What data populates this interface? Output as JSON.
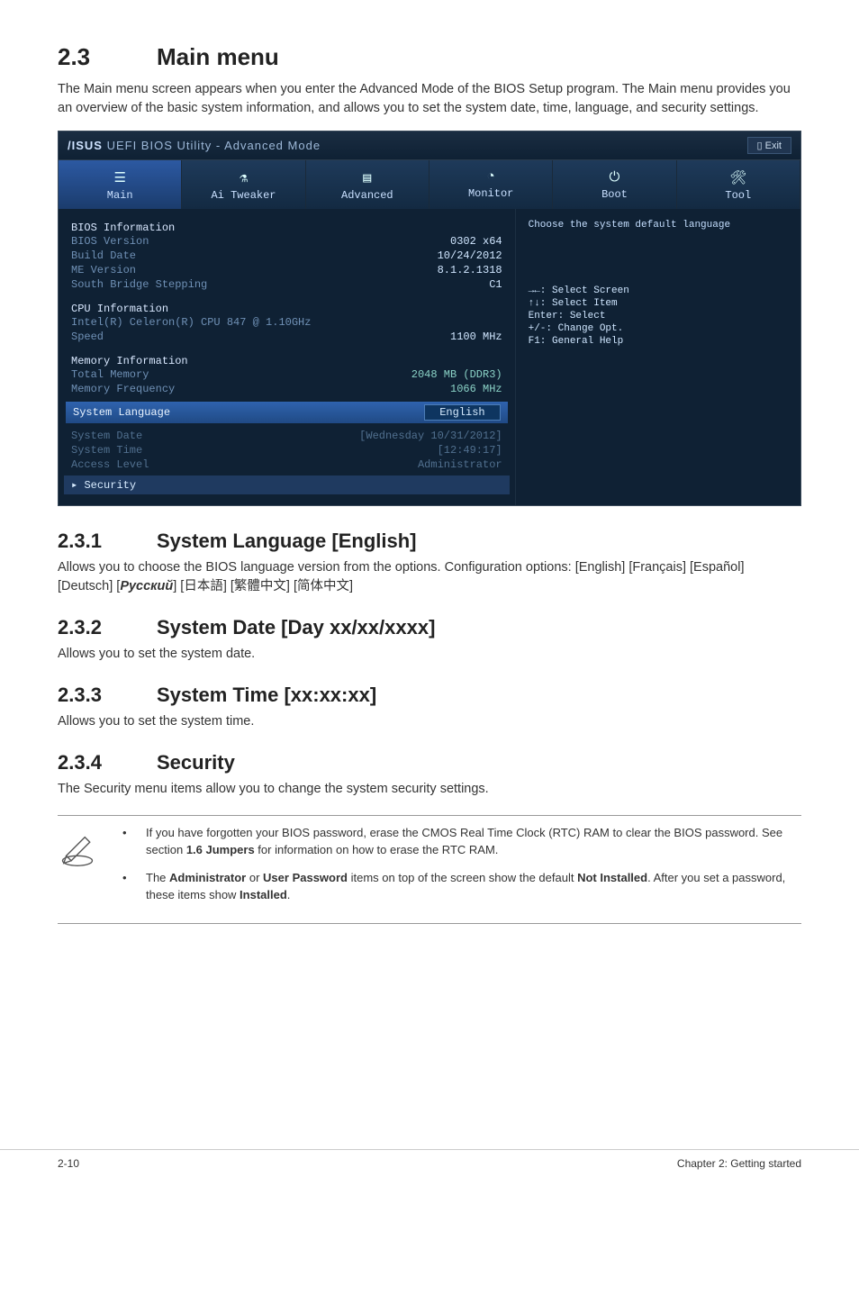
{
  "section": {
    "number": "2.3",
    "title": "Main menu",
    "intro": "The Main menu screen appears when you enter the Advanced Mode of the BIOS Setup program. The Main menu provides you an overview of the basic system information, and allows you to set the system date, time, language, and security settings."
  },
  "bios": {
    "brand_prefix": "/ISUS",
    "brand_rest": " UEFI BIOS Utility - Advanced Mode",
    "exit_label": "Exit",
    "tabs": {
      "main": {
        "label": "Main",
        "icon": "☰"
      },
      "ai": {
        "label": "Ai Tweaker",
        "icon": "⚗"
      },
      "adv": {
        "label": "Advanced",
        "icon": "▤"
      },
      "mon": {
        "label": "Monitor",
        "icon": "◔"
      },
      "boot": {
        "label": "Boot",
        "icon": "⏻"
      },
      "tool": {
        "label": "Tool",
        "icon": "🛠"
      }
    },
    "left": {
      "bios_info_h": "BIOS Information",
      "bios_version_l": "BIOS Version",
      "bios_version_v": "0302 x64",
      "build_date_l": "Build Date",
      "build_date_v": "10/24/2012",
      "me_ver_l": "ME Version",
      "me_ver_v": "8.1.2.1318",
      "sbs_l": "South Bridge Stepping",
      "sbs_v": "C1",
      "cpu_info_h": "CPU Information",
      "cpu_name": "Intel(R) Celeron(R) CPU 847 @ 1.10GHz",
      "speed_l": "Speed",
      "speed_v": "1100 MHz",
      "mem_info_h": "Memory Information",
      "total_mem_l": "Total Memory",
      "total_mem_v": "2048 MB (DDR3)",
      "mem_freq_l": "Memory Frequency",
      "mem_freq_v": "1066 MHz",
      "sys_lang_l": "System Language",
      "sys_lang_v": "English",
      "sys_date_l": "System Date",
      "sys_date_v": "[Wednesday 10/31/2012]",
      "sys_time_l": "System Time",
      "sys_time_v": "[12:49:17]",
      "access_l": "Access Level",
      "access_v": "Administrator",
      "security_l": "Security"
    },
    "right": {
      "help_top": "Choose the system default language",
      "k1": "→←: Select Screen",
      "k2": "↑↓: Select Item",
      "k3": "Enter: Select",
      "k4": "+/-: Change Opt.",
      "k5": "F1: General Help"
    }
  },
  "sub": {
    "s1_num": "2.3.1",
    "s1_title": "System Language [English]",
    "s1_body_a": "Allows you to choose the BIOS language version from the options. Configuration options: [English] [Français] [Español] [Deutsch] [",
    "s1_body_ru": "Русский",
    "s1_body_b": "] [日本語] [繁體中文] [简体中文]",
    "s2_num": "2.3.2",
    "s2_title": "System Date [Day xx/xx/xxxx]",
    "s2_body": "Allows you to set the system date.",
    "s3_num": "2.3.3",
    "s3_title": "System Time [xx:xx:xx]",
    "s3_body": "Allows you to set the system time.",
    "s4_num": "2.3.4",
    "s4_title": "Security",
    "s4_body": "The Security menu items allow you to change the system security settings."
  },
  "notes": {
    "n1a": "If you have forgotten your BIOS password, erase the CMOS Real Time Clock (RTC) RAM to clear the BIOS password. See section ",
    "n1b": "1.6 Jumpers",
    "n1c": " for information on how to erase the RTC RAM.",
    "n2a": "The ",
    "n2b": "Administrator",
    "n2c": " or ",
    "n2d": "User Password",
    "n2e": " items on top of the screen show the default ",
    "n2f": "Not Installed",
    "n2g": ". After you set a password, these items show ",
    "n2h": "Installed",
    "n2i": "."
  },
  "footer": {
    "left": "2-10",
    "right": "Chapter 2: Getting started"
  },
  "chev": "▸ "
}
